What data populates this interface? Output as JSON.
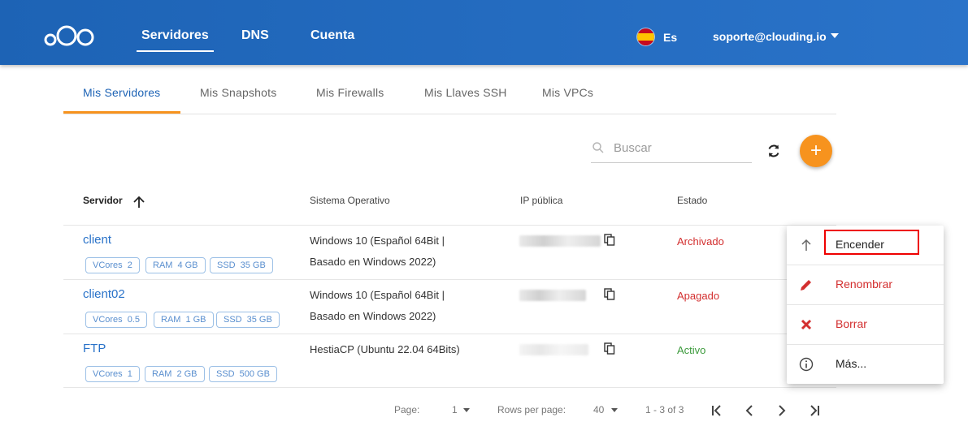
{
  "header": {
    "nav": [
      {
        "label": "Servidores",
        "active": true
      },
      {
        "label": "DNS",
        "active": false
      },
      {
        "label": "Cuenta",
        "active": false
      }
    ],
    "language": "Es",
    "account_email": "soporte@clouding.io"
  },
  "tabs": [
    {
      "label": "Mis Servidores",
      "active": true
    },
    {
      "label": "Mis Snapshots",
      "active": false
    },
    {
      "label": "Mis Firewalls",
      "active": false
    },
    {
      "label": "Mis Llaves SSH",
      "active": false
    },
    {
      "label": "Mis VPCs",
      "active": false
    }
  ],
  "toolbar": {
    "search_placeholder": "Buscar",
    "add_label": "+"
  },
  "table": {
    "columns": [
      "Servidor",
      "Sistema Operativo",
      "IP pública",
      "Estado"
    ],
    "rows": [
      {
        "name": "client",
        "chips": [
          {
            "k": "VCores",
            "v": "2"
          },
          {
            "k": "RAM",
            "v": "4 GB"
          },
          {
            "k": "SSD",
            "v": "35 GB"
          }
        ],
        "os_line1": "Windows 10 (Español 64Bit |",
        "os_line2": "Basado en Windows 2022)",
        "status": "Archivado",
        "status_color": "#d32f2f"
      },
      {
        "name": "client02",
        "chips": [
          {
            "k": "VCores",
            "v": "0.5"
          },
          {
            "k": "RAM",
            "v": "1 GB"
          },
          {
            "k": "SSD",
            "v": "35 GB"
          }
        ],
        "os_line1": "Windows 10 (Español 64Bit |",
        "os_line2": "Basado en Windows 2022)",
        "status": "Apagado",
        "status_color": "#d32f2f"
      },
      {
        "name": "FTP",
        "chips": [
          {
            "k": "VCores",
            "v": "1"
          },
          {
            "k": "RAM",
            "v": "2 GB"
          },
          {
            "k": "SSD",
            "v": "500 GB"
          }
        ],
        "os_line1": "HestiaCP (Ubuntu 22.04 64Bits)",
        "os_line2": "",
        "status": "Activo",
        "status_color": "#3c9a3c"
      }
    ]
  },
  "pagination": {
    "page_label": "Page:",
    "page_value": "1",
    "rows_label": "Rows per page:",
    "rows_value": "40",
    "range": "1 - 3 of 3"
  },
  "context_menu": {
    "items": [
      {
        "label": "Encender",
        "icon": "arrow-up-icon"
      },
      {
        "label": "Renombrar",
        "icon": "pencil-icon"
      },
      {
        "label": "Borrar",
        "icon": "close-icon"
      },
      {
        "label": "Más...",
        "icon": "info-icon"
      }
    ]
  },
  "colors": {
    "brand_blue": "#1d63b5",
    "accent_orange": "#f7931e",
    "danger_red": "#d32f2f",
    "success_green": "#3c9a3c"
  }
}
